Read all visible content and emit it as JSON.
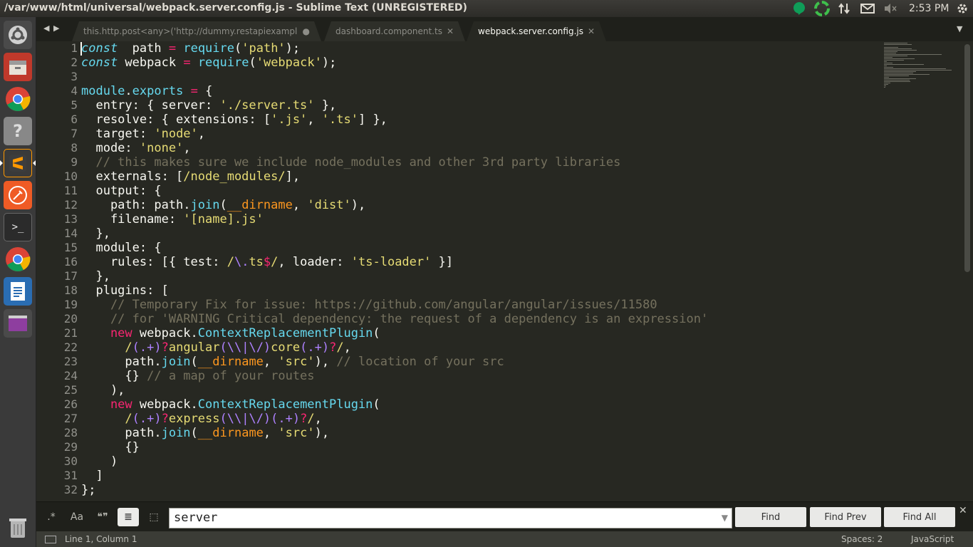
{
  "window": {
    "title": "/var/www/html/universal/webpack.server.config.js - Sublime Text (UNREGISTERED)"
  },
  "tray": {
    "time": "2:53 PM",
    "icons": [
      "hangouts-icon",
      "sync-icon",
      "network-icon",
      "mail-icon",
      "volume-mute-icon",
      "settings-gear-icon"
    ]
  },
  "launcher": {
    "items": [
      "ubuntu-dash-icon",
      "files-icon",
      "chrome-icon",
      "help-icon",
      "sublime-text-icon",
      "postman-icon",
      "terminal-icon",
      "chrome-icon-2",
      "libreoffice-writer-icon",
      "workspace-switcher-icon",
      "trash-icon"
    ]
  },
  "tabs": [
    {
      "label": "this.http.post<any>('http://dummy.restapiexample.c",
      "close": "●",
      "active": false
    },
    {
      "label": "dashboard.component.ts",
      "close": "✕",
      "active": false
    },
    {
      "label": "webpack.server.config.js",
      "close": "✕",
      "active": true
    }
  ],
  "nav": {
    "back": "◀",
    "forward": "▶",
    "overflow": "▼"
  },
  "editor": {
    "line_numbers": [
      "1",
      "2",
      "3",
      "4",
      "5",
      "6",
      "7",
      "8",
      "9",
      "10",
      "11",
      "12",
      "13",
      "14",
      "15",
      "16",
      "17",
      "18",
      "19",
      "20",
      "21",
      "22",
      "23",
      "24",
      "25",
      "26",
      "27",
      "28",
      "29",
      "30",
      "31",
      "32"
    ],
    "lines": [
      [
        [
          "kw-italic",
          "const"
        ],
        [
          "",
          "  path "
        ],
        [
          "kw",
          "="
        ],
        [
          "",
          " "
        ],
        [
          "fn",
          "require"
        ],
        [
          "",
          "("
        ],
        [
          "str",
          "'path'"
        ],
        [
          "",
          ");"
        ]
      ],
      [
        [
          "kw-italic",
          "const"
        ],
        [
          "",
          " webpack "
        ],
        [
          "kw",
          "="
        ],
        [
          "",
          " "
        ],
        [
          "fn",
          "require"
        ],
        [
          "",
          "("
        ],
        [
          "str",
          "'webpack'"
        ],
        [
          "",
          ");"
        ]
      ],
      [],
      [
        [
          "fn",
          "module"
        ],
        [
          "",
          "."
        ],
        [
          "fn",
          "exports"
        ],
        [
          "",
          " "
        ],
        [
          "kw",
          "="
        ],
        [
          "",
          " {"
        ]
      ],
      [
        [
          "",
          "  entry: { server: "
        ],
        [
          "str",
          "'./server.ts'"
        ],
        [
          "",
          " },"
        ]
      ],
      [
        [
          "",
          "  resolve: { extensions: ["
        ],
        [
          "str",
          "'.js'"
        ],
        [
          "",
          ", "
        ],
        [
          "str",
          "'.ts'"
        ],
        [
          "",
          "] },"
        ]
      ],
      [
        [
          "",
          "  target: "
        ],
        [
          "str",
          "'node'"
        ],
        [
          "",
          ","
        ]
      ],
      [
        [
          "",
          "  mode: "
        ],
        [
          "str",
          "'none'"
        ],
        [
          "",
          ","
        ]
      ],
      [
        [
          "cmt",
          "  // this makes sure we include node_modules and other 3rd party libraries"
        ]
      ],
      [
        [
          "",
          "  externals: ["
        ],
        [
          "str",
          "/node_modules/"
        ],
        [
          "",
          "],"
        ]
      ],
      [
        [
          "",
          "  output: {"
        ]
      ],
      [
        [
          "",
          "    path: path."
        ],
        [
          "fn",
          "join"
        ],
        [
          "",
          "("
        ],
        [
          "var",
          "__dirname"
        ],
        [
          "",
          ", "
        ],
        [
          "str",
          "'dist'"
        ],
        [
          "",
          "),"
        ]
      ],
      [
        [
          "",
          "    filename: "
        ],
        [
          "str",
          "'[name].js'"
        ]
      ],
      [
        [
          "",
          "  },"
        ]
      ],
      [
        [
          "",
          "  module: {"
        ]
      ],
      [
        [
          "",
          "    rules: [{ test: "
        ],
        [
          "str",
          "/"
        ],
        [
          "num",
          "\\."
        ],
        [
          "str",
          "ts"
        ],
        [
          "kw",
          "$"
        ],
        [
          "str",
          "/"
        ],
        [
          "",
          ", loader: "
        ],
        [
          "str",
          "'ts-loader'"
        ],
        [
          "",
          " }]"
        ]
      ],
      [
        [
          "",
          "  },"
        ]
      ],
      [
        [
          "",
          "  plugins: ["
        ]
      ],
      [
        [
          "cmt",
          "    // Temporary Fix for issue: https://github.com/angular/angular/issues/11580"
        ]
      ],
      [
        [
          "cmt",
          "    // for 'WARNING Critical dependency: the request of a dependency is an expression'"
        ]
      ],
      [
        [
          "kw",
          "    new"
        ],
        [
          "",
          " webpack."
        ],
        [
          "fn",
          "ContextReplacementPlugin"
        ],
        [
          "",
          "("
        ]
      ],
      [
        [
          "str",
          "      /"
        ],
        [
          "num",
          "(.+)"
        ],
        [
          "kw",
          "?"
        ],
        [
          "str",
          "angular"
        ],
        [
          "num",
          "(\\\\|\\/)"
        ],
        [
          "str",
          "core"
        ],
        [
          "num",
          "(.+)"
        ],
        [
          "kw",
          "?"
        ],
        [
          "str",
          "/"
        ],
        [
          "",
          ","
        ]
      ],
      [
        [
          "",
          "      path."
        ],
        [
          "fn",
          "join"
        ],
        [
          "",
          "("
        ],
        [
          "var",
          "__dirname"
        ],
        [
          "",
          ", "
        ],
        [
          "str",
          "'src'"
        ],
        [
          "",
          "), "
        ],
        [
          "cmt",
          "// location of your src"
        ]
      ],
      [
        [
          "",
          "      {} "
        ],
        [
          "cmt",
          "// a map of your routes"
        ]
      ],
      [
        [
          "",
          "    ),"
        ]
      ],
      [
        [
          "kw",
          "    new"
        ],
        [
          "",
          " webpack."
        ],
        [
          "fn",
          "ContextReplacementPlugin"
        ],
        [
          "",
          "("
        ]
      ],
      [
        [
          "str",
          "      /"
        ],
        [
          "num",
          "(.+)"
        ],
        [
          "kw",
          "?"
        ],
        [
          "str",
          "express"
        ],
        [
          "num",
          "(\\\\|\\/)"
        ],
        [
          "num",
          "(.+)"
        ],
        [
          "kw",
          "?"
        ],
        [
          "str",
          "/"
        ],
        [
          "",
          ","
        ]
      ],
      [
        [
          "",
          "      path."
        ],
        [
          "fn",
          "join"
        ],
        [
          "",
          "("
        ],
        [
          "var",
          "__dirname"
        ],
        [
          "",
          ", "
        ],
        [
          "str",
          "'src'"
        ],
        [
          "",
          "),"
        ]
      ],
      [
        [
          "",
          "      {}"
        ]
      ],
      [
        [
          "",
          "    )"
        ]
      ],
      [
        [
          "",
          "  ]"
        ]
      ],
      [
        [
          "",
          "};"
        ]
      ]
    ]
  },
  "find": {
    "options": [
      ".*",
      "Aa",
      "❝❞",
      "≣",
      "⬚",
      "▭"
    ],
    "query": "server",
    "dropdown": "▼",
    "find_label": "Find",
    "find_prev_label": "Find Prev",
    "find_all_label": "Find All",
    "close": "✕"
  },
  "status": {
    "position": "Line 1, Column 1",
    "spaces": "Spaces: 2",
    "syntax": "JavaScript"
  },
  "colors": {
    "background": "#272822",
    "keyword": "#f92672",
    "string": "#e6db74",
    "function": "#66d9ef",
    "comment": "#75715e",
    "variable": "#fd971f",
    "constant": "#ae81ff"
  }
}
